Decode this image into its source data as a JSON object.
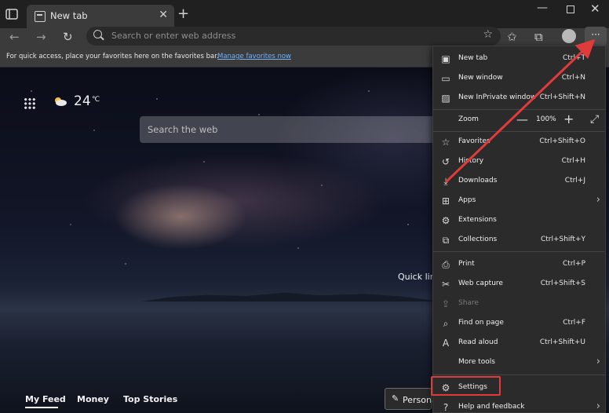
{
  "tab": {
    "title": "New tab",
    "close_glyph": "✕",
    "new_glyph": "+"
  },
  "window_controls": {
    "minimize": "—",
    "close": "✕"
  },
  "toolbar": {
    "back_glyph": "←",
    "forward_glyph": "→",
    "refresh_glyph": "↻",
    "address_placeholder": "Search or enter web address",
    "more_glyph": "···",
    "icons": [
      "back-icon",
      "forward-icon",
      "refresh-icon",
      "search-icon",
      "add-favorite-icon",
      "favorites-icon",
      "collections-icon",
      "profile-avatar",
      "more-icon"
    ]
  },
  "favorites_bar": {
    "message": "For quick access, place your favorites here on the favorites bar.",
    "link": "Manage favorites now"
  },
  "page": {
    "temperature": "24",
    "temp_unit": "℃",
    "search_placeholder": "Search the web",
    "quick_links": "Quick link",
    "feed_tabs": [
      "My Feed",
      "Money",
      "Top Stories"
    ],
    "personalize_label": "Persona",
    "personalize_glyph": "✎"
  },
  "menu": {
    "new_tab": {
      "label": "New tab",
      "shortcut": "Ctrl+T",
      "glyph": "▣"
    },
    "new_window": {
      "label": "New window",
      "shortcut": "Ctrl+N",
      "glyph": "▭"
    },
    "new_inprivate": {
      "label": "New InPrivate window",
      "shortcut": "Ctrl+Shift+N",
      "glyph": "▨"
    },
    "zoom": {
      "label": "Zoom",
      "value": "100%",
      "minus": "—",
      "plus": "+",
      "full": "⤢"
    },
    "favorites": {
      "label": "Favorites",
      "shortcut": "Ctrl+Shift+O",
      "glyph": "☆"
    },
    "history": {
      "label": "History",
      "shortcut": "Ctrl+H",
      "glyph": "↺"
    },
    "downloads": {
      "label": "Downloads",
      "shortcut": "Ctrl+J",
      "glyph": "⤓"
    },
    "apps": {
      "label": "Apps",
      "glyph": "⊞",
      "arrow": "›"
    },
    "extensions": {
      "label": "Extensions",
      "glyph": "⚙"
    },
    "collections": {
      "label": "Collections",
      "shortcut": "Ctrl+Shift+Y",
      "glyph": "⧉"
    },
    "print": {
      "label": "Print",
      "shortcut": "Ctrl+P",
      "glyph": "⎙"
    },
    "web_capture": {
      "label": "Web capture",
      "shortcut": "Ctrl+Shift+S",
      "glyph": "✂"
    },
    "share": {
      "label": "Share",
      "glyph": "⇪"
    },
    "find": {
      "label": "Find on page",
      "shortcut": "Ctrl+F",
      "glyph": "⌕"
    },
    "read_aloud": {
      "label": "Read aloud",
      "shortcut": "Ctrl+Shift+U",
      "glyph": "A"
    },
    "more_tools": {
      "label": "More tools",
      "arrow": "›"
    },
    "settings": {
      "label": "Settings",
      "glyph": "⚙"
    },
    "help": {
      "label": "Help and feedback",
      "glyph": "?",
      "arrow": "›"
    }
  },
  "annotation": {
    "highlight_color": "#e03b3b"
  }
}
